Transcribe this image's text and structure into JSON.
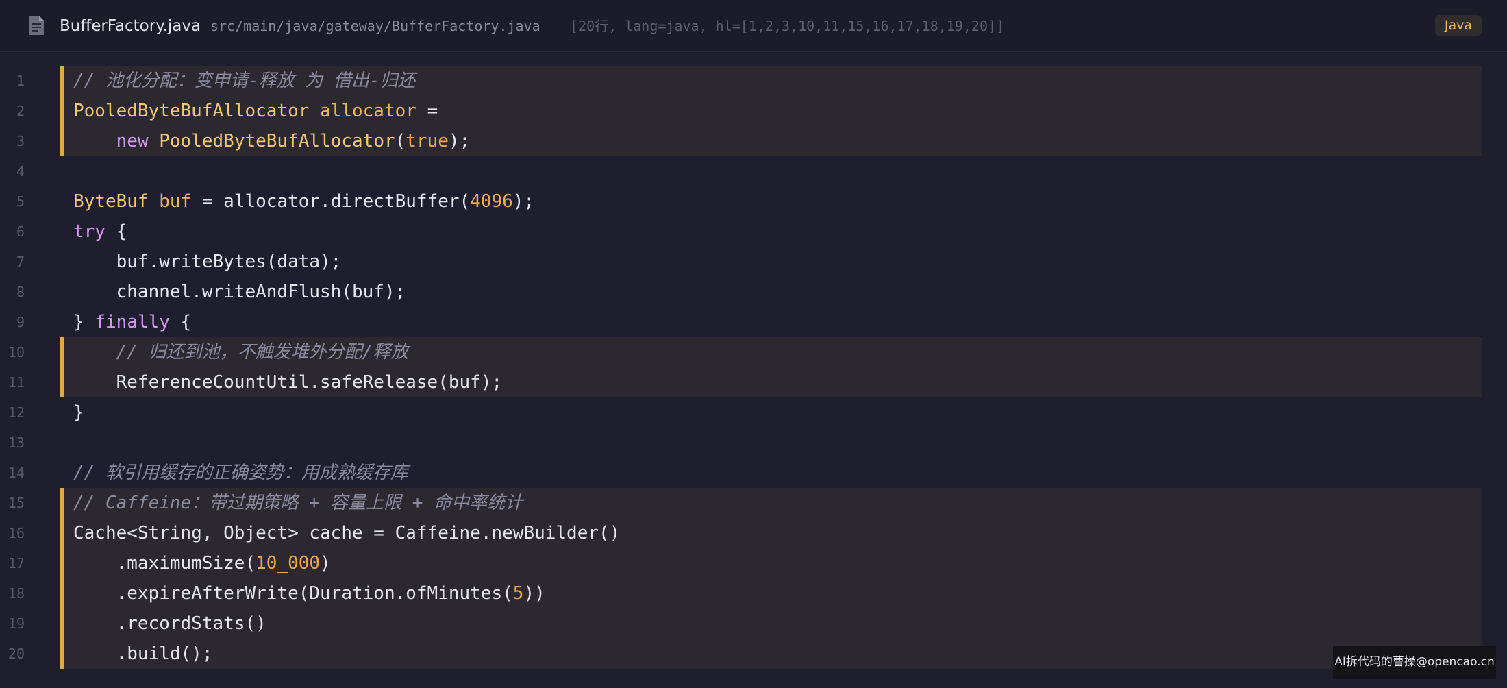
{
  "header": {
    "file_icon": "file-icon",
    "file_name": "BufferFactory.java",
    "file_path": "src/main/java/gateway/BufferFactory.java",
    "meta": "[20行, lang=java, hl=[1,2,3,10,11,15,16,17,18,19,20]]",
    "language": "Java"
  },
  "colors": {
    "background": "#1e1e2e",
    "highlight_background": "#2b2830",
    "highlight_bar": "#e0a948",
    "comment": "#8c8ca0",
    "type": "#f6c677",
    "keyword": "#d59af0",
    "number": "#f0a94e",
    "plain": "#e6e6ef"
  },
  "code": {
    "highlighted_lines": [
      1,
      2,
      3,
      10,
      11,
      15,
      16,
      17,
      18,
      19,
      20
    ],
    "lines": [
      {
        "number": "1",
        "tokens": [
          {
            "t": "comment",
            "text": "// 池化分配：变申请-释放 为 借出-归还"
          }
        ]
      },
      {
        "number": "2",
        "tokens": [
          {
            "t": "type",
            "text": "PooledByteBufAllocator"
          },
          {
            "t": "plain",
            "text": " "
          },
          {
            "t": "var",
            "text": "allocator"
          },
          {
            "t": "plain",
            "text": " ="
          }
        ]
      },
      {
        "number": "3",
        "tokens": [
          {
            "t": "plain",
            "text": "    "
          },
          {
            "t": "keyword",
            "text": "new"
          },
          {
            "t": "plain",
            "text": " "
          },
          {
            "t": "type",
            "text": "PooledByteBufAllocator"
          },
          {
            "t": "plain",
            "text": "("
          },
          {
            "t": "number",
            "text": "true"
          },
          {
            "t": "plain",
            "text": ");"
          }
        ]
      },
      {
        "number": "4",
        "tokens": []
      },
      {
        "number": "5",
        "tokens": [
          {
            "t": "type",
            "text": "ByteBuf"
          },
          {
            "t": "plain",
            "text": " "
          },
          {
            "t": "var",
            "text": "buf"
          },
          {
            "t": "plain",
            "text": " = allocator.directBuffer("
          },
          {
            "t": "number",
            "text": "4096"
          },
          {
            "t": "plain",
            "text": ");"
          }
        ]
      },
      {
        "number": "6",
        "tokens": [
          {
            "t": "keyword",
            "text": "try"
          },
          {
            "t": "plain",
            "text": " {"
          }
        ]
      },
      {
        "number": "7",
        "tokens": [
          {
            "t": "plain",
            "text": "    buf.writeBytes(data);"
          }
        ]
      },
      {
        "number": "8",
        "tokens": [
          {
            "t": "plain",
            "text": "    channel.writeAndFlush(buf);"
          }
        ]
      },
      {
        "number": "9",
        "tokens": [
          {
            "t": "plain",
            "text": "} "
          },
          {
            "t": "keyword",
            "text": "finally"
          },
          {
            "t": "plain",
            "text": " {"
          }
        ]
      },
      {
        "number": "10",
        "tokens": [
          {
            "t": "plain",
            "text": "    "
          },
          {
            "t": "comment",
            "text": "// 归还到池，不触发堆外分配/释放"
          }
        ]
      },
      {
        "number": "11",
        "tokens": [
          {
            "t": "plain",
            "text": "    ReferenceCountUtil.safeRelease(buf);"
          }
        ]
      },
      {
        "number": "12",
        "tokens": [
          {
            "t": "plain",
            "text": "}"
          }
        ]
      },
      {
        "number": "13",
        "tokens": []
      },
      {
        "number": "14",
        "tokens": [
          {
            "t": "comment",
            "text": "// 软引用缓存的正确姿势：用成熟缓存库"
          }
        ]
      },
      {
        "number": "15",
        "tokens": [
          {
            "t": "comment",
            "text": "// Caffeine：带过期策略 + 容量上限 + 命中率统计"
          }
        ]
      },
      {
        "number": "16",
        "tokens": [
          {
            "t": "plain",
            "text": "Cache<String, Object> cache = Caffeine.newBuilder()"
          }
        ]
      },
      {
        "number": "17",
        "tokens": [
          {
            "t": "plain",
            "text": "    .maximumSize("
          },
          {
            "t": "number",
            "text": "10_000"
          },
          {
            "t": "plain",
            "text": ")"
          }
        ]
      },
      {
        "number": "18",
        "tokens": [
          {
            "t": "plain",
            "text": "    .expireAfterWrite(Duration.ofMinutes("
          },
          {
            "t": "number",
            "text": "5"
          },
          {
            "t": "plain",
            "text": "))"
          }
        ]
      },
      {
        "number": "19",
        "tokens": [
          {
            "t": "plain",
            "text": "    .recordStats()"
          }
        ]
      },
      {
        "number": "20",
        "tokens": [
          {
            "t": "plain",
            "text": "    .build();"
          }
        ]
      }
    ]
  },
  "watermark": {
    "text": "AI拆代码的曹操@opencao.cn"
  }
}
